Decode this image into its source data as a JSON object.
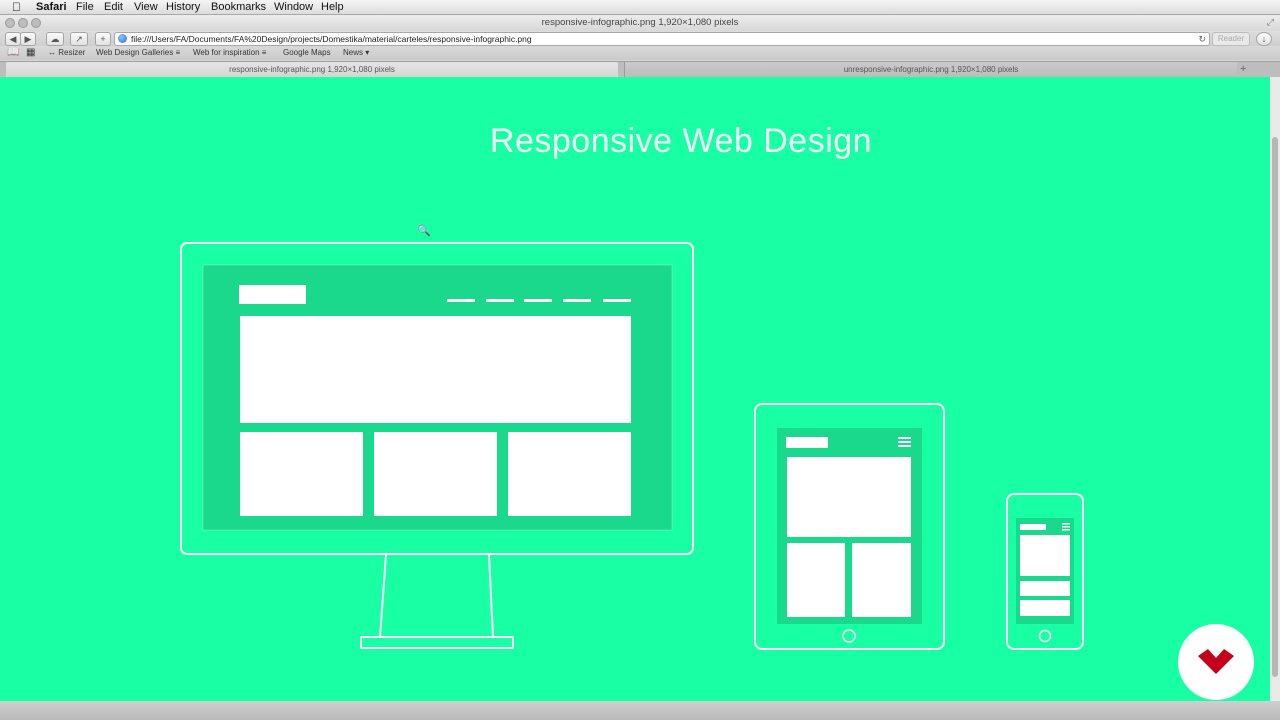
{
  "menubar": {
    "app_name": "Safari",
    "items": [
      "File",
      "Edit",
      "View",
      "History",
      "Bookmarks",
      "Window",
      "Help"
    ]
  },
  "window": {
    "title": "responsive-infographic.png 1,920×1,080 pixels"
  },
  "toolbar": {
    "url": "file:///Users/FA/Documents/FA%20Design/projects/Domestika/material/carteles/responsive-infographic.png",
    "reader_label": "Reader"
  },
  "bookmarks": {
    "items": [
      "↔ Resizer",
      "Web Design Galleries ≡",
      "Web for inspiration ≡",
      "Google Maps",
      "News ▾"
    ]
  },
  "tabs": [
    {
      "label": "responsive-infographic.png 1,920×1,080 pixels",
      "active": true
    },
    {
      "label": "unresponsive-infographic.png 1,920×1,080 pixels",
      "active": false
    }
  ],
  "content": {
    "headline": "Responsive Web Design",
    "colors": {
      "background": "#19ffa4",
      "screen": "#1ad98c",
      "outline": "#ffffff",
      "logo": "#c4001a"
    },
    "devices": [
      "desktop-monitor",
      "tablet",
      "smartphone"
    ]
  }
}
